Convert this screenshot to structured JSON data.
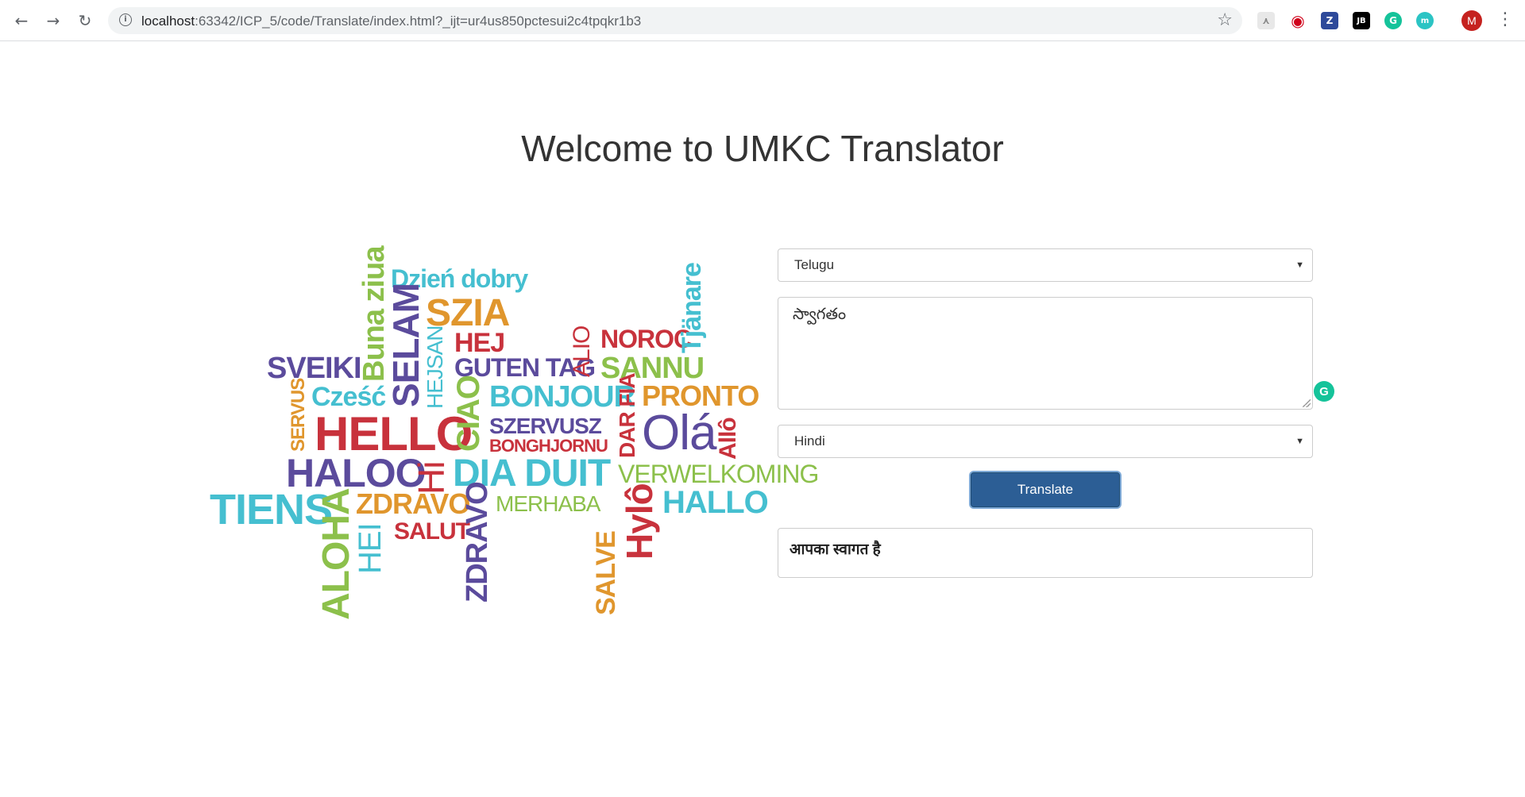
{
  "browser": {
    "url_host": "localhost",
    "url_rest": ":63342/ICP_5/code/Translate/index.html?_ijt=ur4us850pctesui2c4tpqkr1b3",
    "avatar_letter": "M",
    "extensions": [
      "pdf-icon",
      "opera-icon",
      "zotero-icon",
      "jetbrains-icon",
      "grammarly-icon",
      "mercury-icon"
    ]
  },
  "page": {
    "title": "Welcome to UMKC Translator"
  },
  "wordcloud": {
    "words": [
      "Buna ziua",
      "Dzień dobry",
      "SZIA",
      "SELAM",
      "HEJSAN",
      "HEJ",
      "SVEIKI",
      "GUTEN TAG",
      "ALIO",
      "NOROC",
      "Tjänare",
      "SANNU",
      "SERVUS",
      "Cześć",
      "BONJOUR",
      "PRONTO",
      "HELLO",
      "CIAO",
      "SZERVUSZ",
      "BONGHJORNU",
      "DAR FIA",
      "Olá",
      "Allô",
      "HALOO",
      "Hi",
      "DIA DUIT",
      "SALVE",
      "VERWELKOMING",
      "TIENS",
      "ALOHA",
      "ZDRAVO",
      "MERHABA",
      "Hylô",
      "HALLO",
      "HEI",
      "SALUT",
      "ZDRAVO"
    ],
    "colors": {
      "purple": "#5b4b9c",
      "green": "#8cc04b",
      "red": "#c8323c",
      "orange": "#e0962d",
      "teal": "#45bfd0"
    }
  },
  "form": {
    "source_language": "Telugu",
    "input_text": "స్వాగతం",
    "target_language": "Hindi",
    "translate_label": "Translate",
    "output_text": "आपका स्वागत है"
  }
}
